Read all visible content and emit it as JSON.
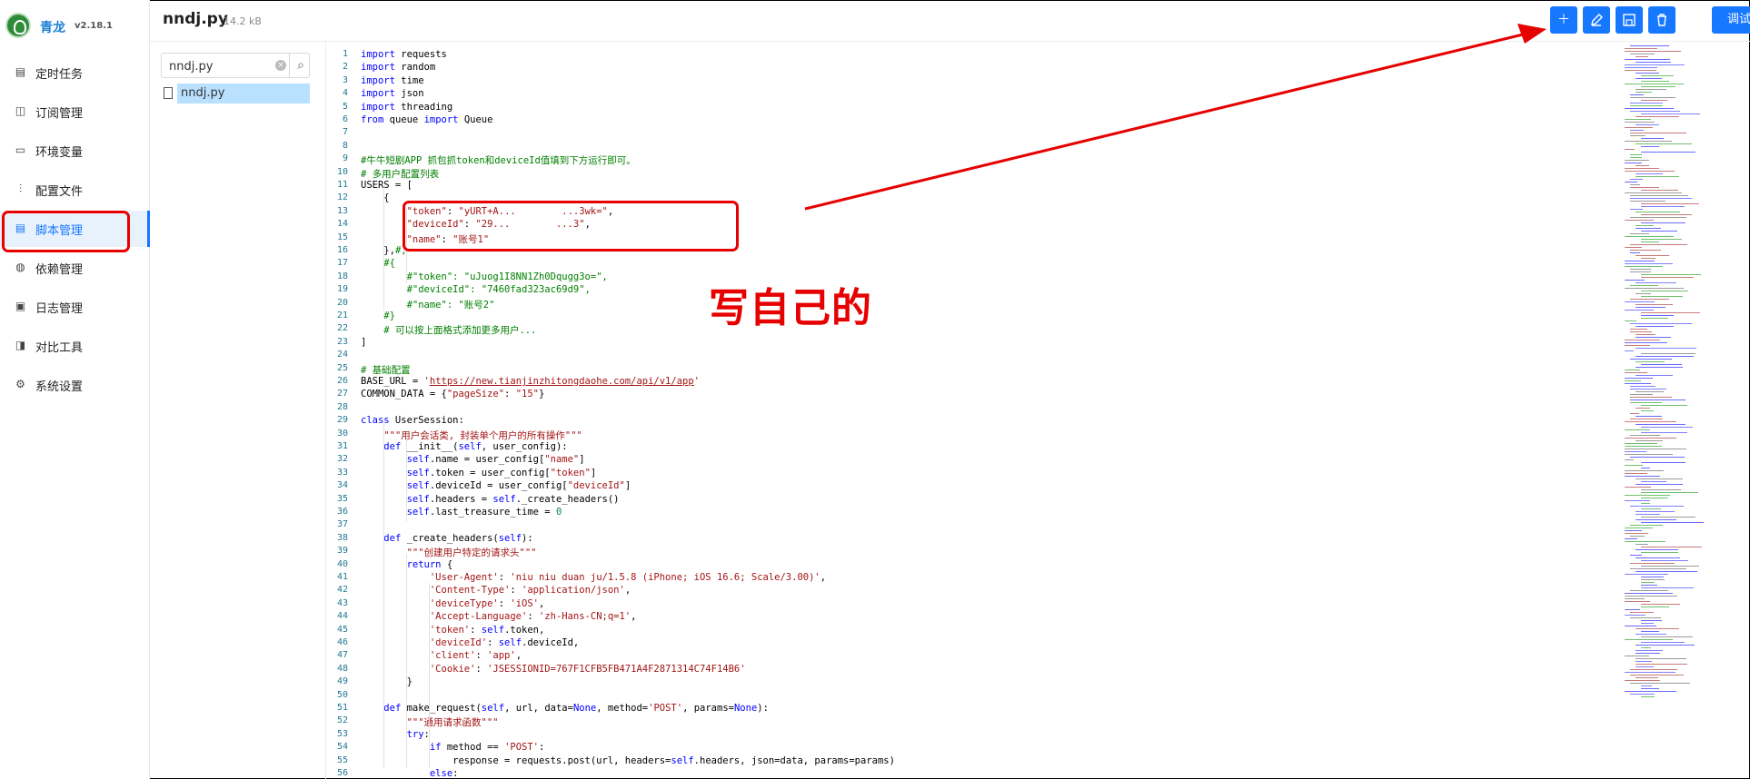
{
  "app": {
    "name": "青龙",
    "version": "v2.18.1"
  },
  "sidebar": {
    "items": [
      {
        "label": "定时任务",
        "icon": "calendar-icon",
        "glyph": "▤"
      },
      {
        "label": "订阅管理",
        "icon": "subscription-icon",
        "glyph": "◫"
      },
      {
        "label": "环境变量",
        "icon": "desktop-icon",
        "glyph": "▭"
      },
      {
        "label": "配置文件",
        "icon": "sliders-icon",
        "glyph": "⫶"
      },
      {
        "label": "脚本管理",
        "icon": "file-code-icon",
        "glyph": "▤"
      },
      {
        "label": "依赖管理",
        "icon": "package-icon",
        "glyph": "◍"
      },
      {
        "label": "日志管理",
        "icon": "log-icon",
        "glyph": "▣"
      },
      {
        "label": "对比工具",
        "icon": "diff-icon",
        "glyph": "◨"
      },
      {
        "label": "系统设置",
        "icon": "gear-icon",
        "glyph": "⚙"
      }
    ],
    "active_index": 4
  },
  "header": {
    "file_name": "nndj.py",
    "file_size": "14.2 kB",
    "debug_label": "调试",
    "toolbar_icons": [
      "plus-icon",
      "edit-icon",
      "save-icon",
      "delete-icon"
    ]
  },
  "tree": {
    "search_value": "nndj.py",
    "files": [
      "nndj.py"
    ]
  },
  "annotation": {
    "text": "写自己的"
  },
  "colors": {
    "accent": "#1677ff",
    "annotation_red": "#e60000"
  },
  "code": {
    "lines": [
      [
        [
          "k",
          "import"
        ],
        [
          "t",
          " requests"
        ]
      ],
      [
        [
          "k",
          "import"
        ],
        [
          "t",
          " random"
        ]
      ],
      [
        [
          "k",
          "import"
        ],
        [
          "t",
          " time"
        ]
      ],
      [
        [
          "k",
          "import"
        ],
        [
          "t",
          " json"
        ]
      ],
      [
        [
          "k",
          "import"
        ],
        [
          "t",
          " threading"
        ]
      ],
      [
        [
          "k",
          "from"
        ],
        [
          "t",
          " queue "
        ],
        [
          "k",
          "import"
        ],
        [
          "t",
          " Queue"
        ]
      ],
      [],
      [],
      [
        [
          "c",
          "#牛牛短剧APP 抓包抓token和deviceId值填到下方运行即可。"
        ]
      ],
      [
        [
          "c",
          "# 多用户配置列表"
        ]
      ],
      [
        [
          "t",
          "USERS = ["
        ]
      ],
      [
        [
          "t",
          "    {"
        ]
      ],
      [
        [
          "t",
          "        "
        ],
        [
          "s",
          "\"token\""
        ],
        [
          "t",
          ": "
        ],
        [
          "s",
          "\"yURT+A...        ...3wk=\""
        ],
        [
          "t",
          ","
        ]
      ],
      [
        [
          "t",
          "        "
        ],
        [
          "s",
          "\"deviceId\""
        ],
        [
          "t",
          ": "
        ],
        [
          "s",
          "\"29...        ...3\""
        ],
        [
          "t",
          ","
        ]
      ],
      [
        [
          "t",
          "        "
        ],
        [
          "s",
          "\"name\""
        ],
        [
          "t",
          ": "
        ],
        [
          "s",
          "\"账号1\""
        ]
      ],
      [
        [
          "t",
          "    },"
        ],
        [
          "c",
          "#,"
        ]
      ],
      [
        [
          "t",
          "    "
        ],
        [
          "c",
          "#{"
        ]
      ],
      [
        [
          "t",
          "        "
        ],
        [
          "c",
          "#\"token\": \"uJuog1I8NN1Zh0Dqugg3o=\","
        ]
      ],
      [
        [
          "t",
          "        "
        ],
        [
          "c",
          "#\"deviceId\": \"7460fad323ac69d9\","
        ]
      ],
      [
        [
          "t",
          "        "
        ],
        [
          "c",
          "#\"name\": \"账号2\""
        ]
      ],
      [
        [
          "t",
          "    "
        ],
        [
          "c",
          "#}"
        ]
      ],
      [
        [
          "t",
          "    "
        ],
        [
          "c",
          "# 可以按上面格式添加更多用户..."
        ]
      ],
      [
        [
          "t",
          "]"
        ]
      ],
      [],
      [
        [
          "c",
          "# 基础配置"
        ]
      ],
      [
        [
          "t",
          "BASE_URL = "
        ],
        [
          "s",
          "'"
        ],
        [
          "u",
          "https://new.tianjinzhitongdaohe.com/api/v1/app"
        ],
        [
          "s",
          "'"
        ]
      ],
      [
        [
          "t",
          "COMMON_DATA = {"
        ],
        [
          "s",
          "\"pageSize\""
        ],
        [
          "t",
          ": "
        ],
        [
          "s",
          "\"15\""
        ],
        [
          "t",
          "}"
        ]
      ],
      [],
      [
        [
          "k",
          "class"
        ],
        [
          "t",
          " UserSession:"
        ]
      ],
      [
        [
          "t",
          "    "
        ],
        [
          "s",
          "\"\"\"用户会话类, 封装单个用户的所有操作\"\"\""
        ]
      ],
      [
        [
          "t",
          "    "
        ],
        [
          "k",
          "def"
        ],
        [
          "t",
          " __init__("
        ],
        [
          "k",
          "self"
        ],
        [
          "t",
          ", user_config):"
        ]
      ],
      [
        [
          "t",
          "        "
        ],
        [
          "k",
          "self"
        ],
        [
          "t",
          ".name = user_config["
        ],
        [
          "s",
          "\"name\""
        ],
        [
          "t",
          "]"
        ]
      ],
      [
        [
          "t",
          "        "
        ],
        [
          "k",
          "self"
        ],
        [
          "t",
          ".token = user_config["
        ],
        [
          "s",
          "\"token\""
        ],
        [
          "t",
          "]"
        ]
      ],
      [
        [
          "t",
          "        "
        ],
        [
          "k",
          "self"
        ],
        [
          "t",
          ".deviceId = user_config["
        ],
        [
          "s",
          "\"deviceId\""
        ],
        [
          "t",
          "]"
        ]
      ],
      [
        [
          "t",
          "        "
        ],
        [
          "k",
          "self"
        ],
        [
          "t",
          ".headers = "
        ],
        [
          "k",
          "self"
        ],
        [
          "t",
          "._create_headers()"
        ]
      ],
      [
        [
          "t",
          "        "
        ],
        [
          "k",
          "self"
        ],
        [
          "t",
          ".last_treasure_time = "
        ],
        [
          "n",
          "0"
        ]
      ],
      [],
      [
        [
          "t",
          "    "
        ],
        [
          "k",
          "def"
        ],
        [
          "t",
          " _create_headers("
        ],
        [
          "k",
          "self"
        ],
        [
          "t",
          "):"
        ]
      ],
      [
        [
          "t",
          "        "
        ],
        [
          "s",
          "\"\"\"创建用户特定的请求头\"\"\""
        ]
      ],
      [
        [
          "t",
          "        "
        ],
        [
          "k",
          "return"
        ],
        [
          "t",
          " {"
        ]
      ],
      [
        [
          "t",
          "            "
        ],
        [
          "s",
          "'User-Agent'"
        ],
        [
          "t",
          ": "
        ],
        [
          "s",
          "'niu niu duan ju/1.5.8 (iPhone; iOS 16.6; Scale/3.00)'"
        ],
        [
          "t",
          ","
        ]
      ],
      [
        [
          "t",
          "            "
        ],
        [
          "s",
          "'Content-Type'"
        ],
        [
          "t",
          ": "
        ],
        [
          "s",
          "'application/json'"
        ],
        [
          "t",
          ","
        ]
      ],
      [
        [
          "t",
          "            "
        ],
        [
          "s",
          "'deviceType'"
        ],
        [
          "t",
          ": "
        ],
        [
          "s",
          "'iOS'"
        ],
        [
          "t",
          ","
        ]
      ],
      [
        [
          "t",
          "            "
        ],
        [
          "s",
          "'Accept-Language'"
        ],
        [
          "t",
          ": "
        ],
        [
          "s",
          "'zh-Hans-CN;q=1'"
        ],
        [
          "t",
          ","
        ]
      ],
      [
        [
          "t",
          "            "
        ],
        [
          "s",
          "'token'"
        ],
        [
          "t",
          ": "
        ],
        [
          "k",
          "self"
        ],
        [
          "t",
          ".token,"
        ]
      ],
      [
        [
          "t",
          "            "
        ],
        [
          "s",
          "'deviceId'"
        ],
        [
          "t",
          ": "
        ],
        [
          "k",
          "self"
        ],
        [
          "t",
          ".deviceId,"
        ]
      ],
      [
        [
          "t",
          "            "
        ],
        [
          "s",
          "'client'"
        ],
        [
          "t",
          ": "
        ],
        [
          "s",
          "'app'"
        ],
        [
          "t",
          ","
        ]
      ],
      [
        [
          "t",
          "            "
        ],
        [
          "s",
          "'Cookie'"
        ],
        [
          "t",
          ": "
        ],
        [
          "s",
          "'JSESSIONID=767F1CFB5FB471A4F2871314C74F14B6'"
        ]
      ],
      [
        [
          "t",
          "        }"
        ]
      ],
      [],
      [
        [
          "t",
          "    "
        ],
        [
          "k",
          "def"
        ],
        [
          "t",
          " make_request("
        ],
        [
          "k",
          "self"
        ],
        [
          "t",
          ", url, data="
        ],
        [
          "k",
          "None"
        ],
        [
          "t",
          ", method="
        ],
        [
          "s",
          "'POST'"
        ],
        [
          "t",
          ", params="
        ],
        [
          "k",
          "None"
        ],
        [
          "t",
          "):"
        ]
      ],
      [
        [
          "t",
          "        "
        ],
        [
          "s",
          "\"\"\"通用请求函数\"\"\""
        ]
      ],
      [
        [
          "t",
          "        "
        ],
        [
          "k",
          "try"
        ],
        [
          "t",
          ":"
        ]
      ],
      [
        [
          "t",
          "            "
        ],
        [
          "k",
          "if"
        ],
        [
          "t",
          " method == "
        ],
        [
          "s",
          "'POST'"
        ],
        [
          "t",
          ":"
        ]
      ],
      [
        [
          "t",
          "                response = requests.post(url, headers="
        ],
        [
          "k",
          "self"
        ],
        [
          "t",
          ".headers, json=data, params=params)"
        ]
      ],
      [
        [
          "t",
          "            "
        ],
        [
          "k",
          "else"
        ],
        [
          "t",
          ":"
        ]
      ]
    ]
  }
}
